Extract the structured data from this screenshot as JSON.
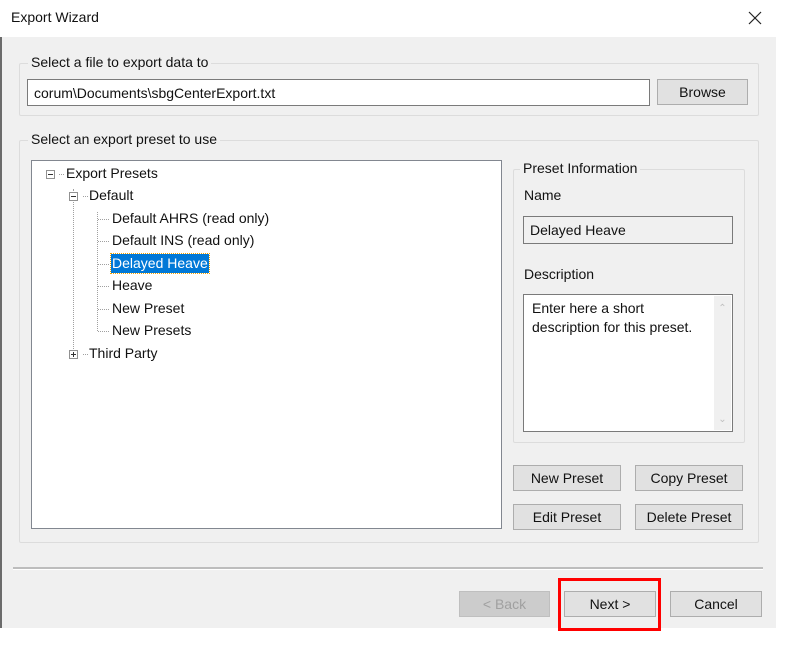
{
  "window": {
    "title": "Export Wizard",
    "close_icon": "close-icon"
  },
  "file_section": {
    "legend": "Select a file to export data to",
    "path_value": "corum\\Documents\\sbgCenterExport.txt",
    "browse_label": "Browse"
  },
  "preset_section": {
    "legend": "Select an export preset to use",
    "tree": {
      "root": "Export Presets",
      "groups": [
        {
          "label": "Default",
          "expanded": true,
          "items": [
            "Default AHRS (read only)",
            "Default INS (read only)",
            "Delayed Heave",
            "Heave",
            "New Preset",
            "New Presets"
          ]
        },
        {
          "label": "Third Party",
          "expanded": false,
          "items": []
        }
      ],
      "selected": "Delayed Heave"
    },
    "info": {
      "legend": "Preset Information",
      "name_label": "Name",
      "name_value": "Delayed Heave",
      "description_label": "Description",
      "description_value": "Enter here a short description for this preset."
    },
    "buttons": {
      "new_preset": "New Preset",
      "copy_preset": "Copy Preset",
      "edit_preset": "Edit Preset",
      "delete_preset": "Delete Preset"
    }
  },
  "footer": {
    "back_label": "< Back",
    "back_enabled": false,
    "next_label": "Next >",
    "cancel_label": "Cancel",
    "highlight_color": "#ff0000"
  },
  "colors": {
    "selection": "#0078d7",
    "dialog_bg": "#f0f0f0"
  }
}
